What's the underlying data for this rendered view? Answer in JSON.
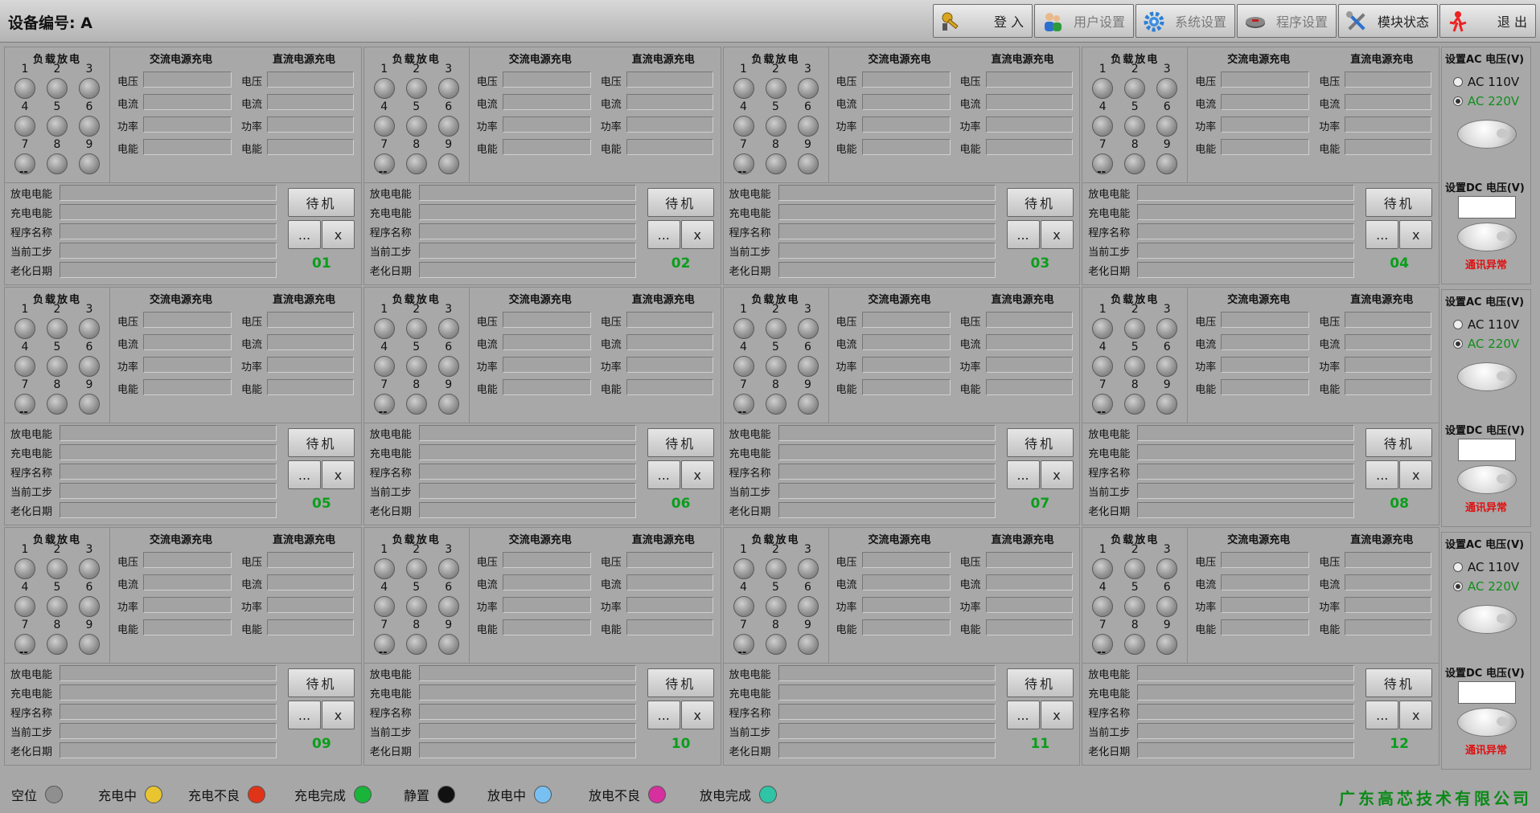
{
  "header": {
    "device_label": "设备编号: A",
    "buttons": [
      {
        "label": "登 入",
        "icon": "key-icon"
      },
      {
        "label": "用户设置",
        "icon": "users-icon"
      },
      {
        "label": "系统设置",
        "icon": "gear-icon"
      },
      {
        "label": "程序设置",
        "icon": "program-icon"
      },
      {
        "label": "模块状态",
        "icon": "tools-icon"
      },
      {
        "label": "退 出",
        "icon": "exit-icon"
      }
    ]
  },
  "station_labels": {
    "load_discharge": "负载放电",
    "ac_charge": "交流电源充电",
    "dc_charge": "直流电源充电",
    "lamp_numbers": [
      "1",
      "2",
      "3",
      "4",
      "5",
      "6",
      "7",
      "8",
      "9"
    ],
    "voltage": "电压",
    "current": "电流",
    "power": "功率",
    "energy": "电能",
    "dashes": "--",
    "discharge_energy": "放电电能",
    "charge_energy": "充电电能",
    "program_name": "程序名称",
    "current_step": "当前工步",
    "aging_date": "老化日期",
    "standby_button": "待机",
    "more_button": "...",
    "close_button": "x"
  },
  "stations": [
    "01",
    "02",
    "03",
    "04",
    "05",
    "06",
    "07",
    "08",
    "09",
    "10",
    "11",
    "12"
  ],
  "side_panels": [
    {
      "ac_title": "设置AC 电压(V)",
      "ac_110": "AC 110V",
      "ac_220": "AC 220V",
      "ac_selected": "AC 220V",
      "dc_title": "设置DC 电压(V)",
      "comm_status": "通讯异常"
    },
    {
      "ac_title": "设置AC 电压(V)",
      "ac_110": "AC 110V",
      "ac_220": "AC 220V",
      "ac_selected": "AC 220V",
      "dc_title": "设置DC 电压(V)",
      "comm_status": "通讯异常"
    },
    {
      "ac_title": "设置AC 电压(V)",
      "ac_110": "AC 110V",
      "ac_220": "AC 220V",
      "ac_selected": "AC 220V",
      "dc_title": "设置DC 电压(V)",
      "comm_status": "通讯异常"
    }
  ],
  "legend": [
    {
      "label": "空位",
      "color": "#8f8f8f"
    },
    {
      "label": "充电中",
      "color": "#e8c430"
    },
    {
      "label": "充电不良",
      "color": "#e03418"
    },
    {
      "label": "充电完成",
      "color": "#19b43a"
    },
    {
      "label": "静置",
      "color": "#111111"
    },
    {
      "label": "放电中",
      "color": "#79c0f2"
    },
    {
      "label": "放电不良",
      "color": "#d62f9e"
    },
    {
      "label": "放电完成",
      "color": "#2fc4a5"
    }
  ],
  "company": "广东高芯技术有限公司"
}
